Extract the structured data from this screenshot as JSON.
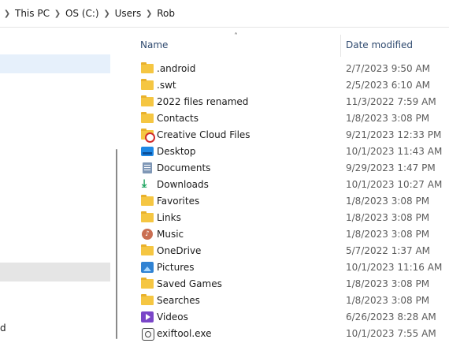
{
  "address_bar": {
    "crumbs": [
      "This PC",
      "OS (C:)",
      "Users",
      "Rob"
    ]
  },
  "navigation": {
    "partial_label": "d"
  },
  "file_list": {
    "columns": {
      "name": "Name",
      "date_modified": "Date modified"
    },
    "sort": {
      "column": "name",
      "direction": "ascending"
    },
    "rows": [
      {
        "name": ".android",
        "date": "2/7/2023 9:50 AM",
        "icon": "folder-icon"
      },
      {
        "name": ".swt",
        "date": "2/5/2023 6:10 AM",
        "icon": "folder-icon"
      },
      {
        "name": "2022 files renamed",
        "date": "11/3/2022 7:59 AM",
        "icon": "folder-icon"
      },
      {
        "name": "Contacts",
        "date": "1/8/2023 3:08 PM",
        "icon": "folder-icon"
      },
      {
        "name": "Creative Cloud Files",
        "date": "9/21/2023 12:33 PM",
        "icon": "creative-cloud-folder-icon"
      },
      {
        "name": "Desktop",
        "date": "10/1/2023 11:43 AM",
        "icon": "desktop-folder-icon"
      },
      {
        "name": "Documents",
        "date": "9/29/2023 1:47 PM",
        "icon": "documents-folder-icon"
      },
      {
        "name": "Downloads",
        "date": "10/1/2023 10:27 AM",
        "icon": "downloads-folder-icon"
      },
      {
        "name": "Favorites",
        "date": "1/8/2023 3:08 PM",
        "icon": "folder-icon"
      },
      {
        "name": "Links",
        "date": "1/8/2023 3:08 PM",
        "icon": "folder-icon"
      },
      {
        "name": "Music",
        "date": "1/8/2023 3:08 PM",
        "icon": "music-folder-icon"
      },
      {
        "name": "OneDrive",
        "date": "5/7/2022 1:37 AM",
        "icon": "folder-icon"
      },
      {
        "name": "Pictures",
        "date": "10/1/2023 11:16 AM",
        "icon": "pictures-folder-icon"
      },
      {
        "name": "Saved Games",
        "date": "1/8/2023 3:08 PM",
        "icon": "folder-icon"
      },
      {
        "name": "Searches",
        "date": "1/8/2023 3:08 PM",
        "icon": "folder-icon"
      },
      {
        "name": "Videos",
        "date": "6/26/2023 8:28 AM",
        "icon": "videos-folder-icon"
      },
      {
        "name": "exiftool.exe",
        "date": "10/1/2023 7:55 AM",
        "icon": "exiftool-exe-icon"
      }
    ]
  }
}
